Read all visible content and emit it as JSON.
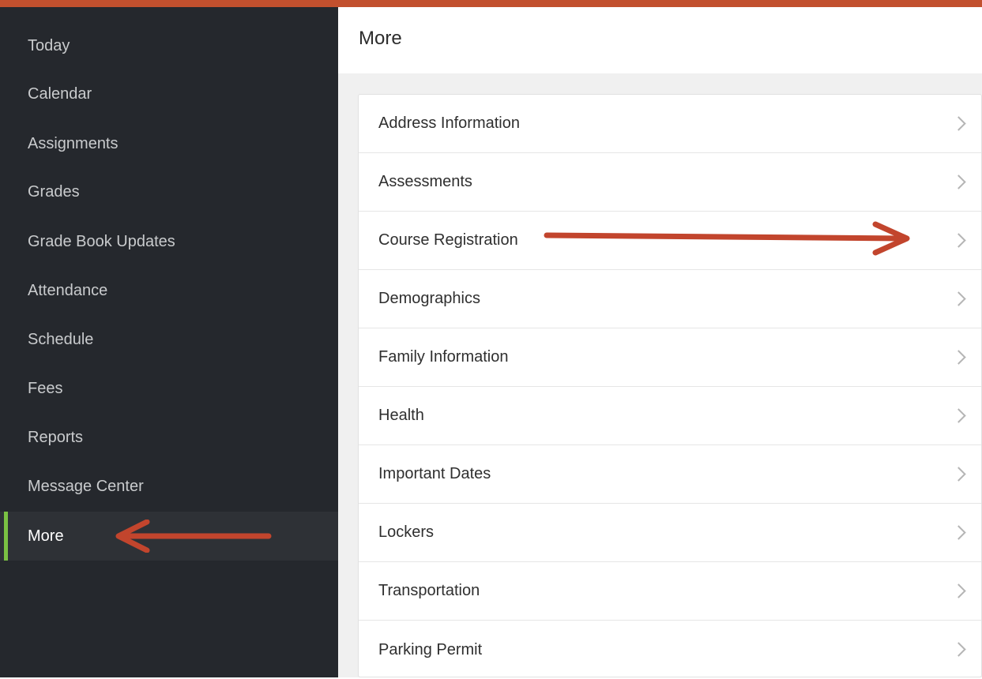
{
  "sidebar": {
    "items": [
      {
        "label": "Today"
      },
      {
        "label": "Calendar"
      },
      {
        "label": "Assignments"
      },
      {
        "label": "Grades"
      },
      {
        "label": "Grade Book Updates"
      },
      {
        "label": "Attendance"
      },
      {
        "label": "Schedule"
      },
      {
        "label": "Fees"
      },
      {
        "label": "Reports"
      },
      {
        "label": "Message Center"
      },
      {
        "label": "More"
      }
    ],
    "active_index": 10
  },
  "main": {
    "title": "More",
    "items": [
      {
        "label": "Address Information"
      },
      {
        "label": "Assessments"
      },
      {
        "label": "Course Registration"
      },
      {
        "label": "Demographics"
      },
      {
        "label": "Family Information"
      },
      {
        "label": "Health"
      },
      {
        "label": "Important Dates"
      },
      {
        "label": "Lockers"
      },
      {
        "label": "Transportation"
      },
      {
        "label": "Parking Permit"
      }
    ]
  },
  "colors": {
    "accent_top_bar": "#c2502e",
    "sidebar_bg": "#25282d",
    "active_indicator": "#7ac143",
    "annotation_arrow": "#c2452d"
  },
  "icons": {
    "row_chevron": "chevron-right-icon"
  }
}
